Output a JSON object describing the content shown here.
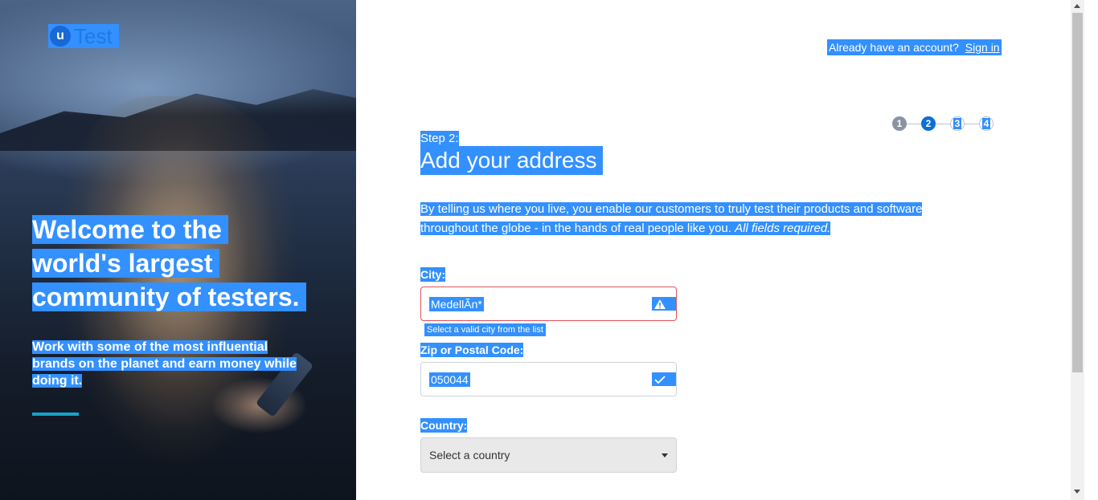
{
  "brand": {
    "logo_letter": "u",
    "logo_word": "Test"
  },
  "hero": {
    "headline_lines": [
      "Welcome to the",
      "world's largest",
      "community of testers."
    ],
    "subtext_lines": [
      "Work with some of the most influential",
      "brands on the planet and earn money while",
      "doing it."
    ]
  },
  "header": {
    "prompt": "Already have an account?",
    "signin_label": "Sign in"
  },
  "steps": {
    "items": [
      "1",
      "2",
      "3",
      "4"
    ],
    "current": 2
  },
  "form": {
    "step_label": "Step 2:",
    "title": "Add your address",
    "description": "By telling us where you live, you enable our customers to truly test their products and software throughout the globe - in the hands of real people like you.",
    "description_note": "All fields required.",
    "city": {
      "label": "City:",
      "value": "MedellÃn*",
      "error": "Select a valid city from the list",
      "status_icon": "warning-icon"
    },
    "zip": {
      "label": "Zip or Postal Code:",
      "value": "050044",
      "status_icon": "check-icon"
    },
    "country": {
      "label": "Country:",
      "placeholder": "Select a country"
    }
  },
  "colors": {
    "accent": "#0b6fd6",
    "selection": "#3390ff",
    "error": "#e0525a",
    "hero_bar": "#16a2c8"
  }
}
